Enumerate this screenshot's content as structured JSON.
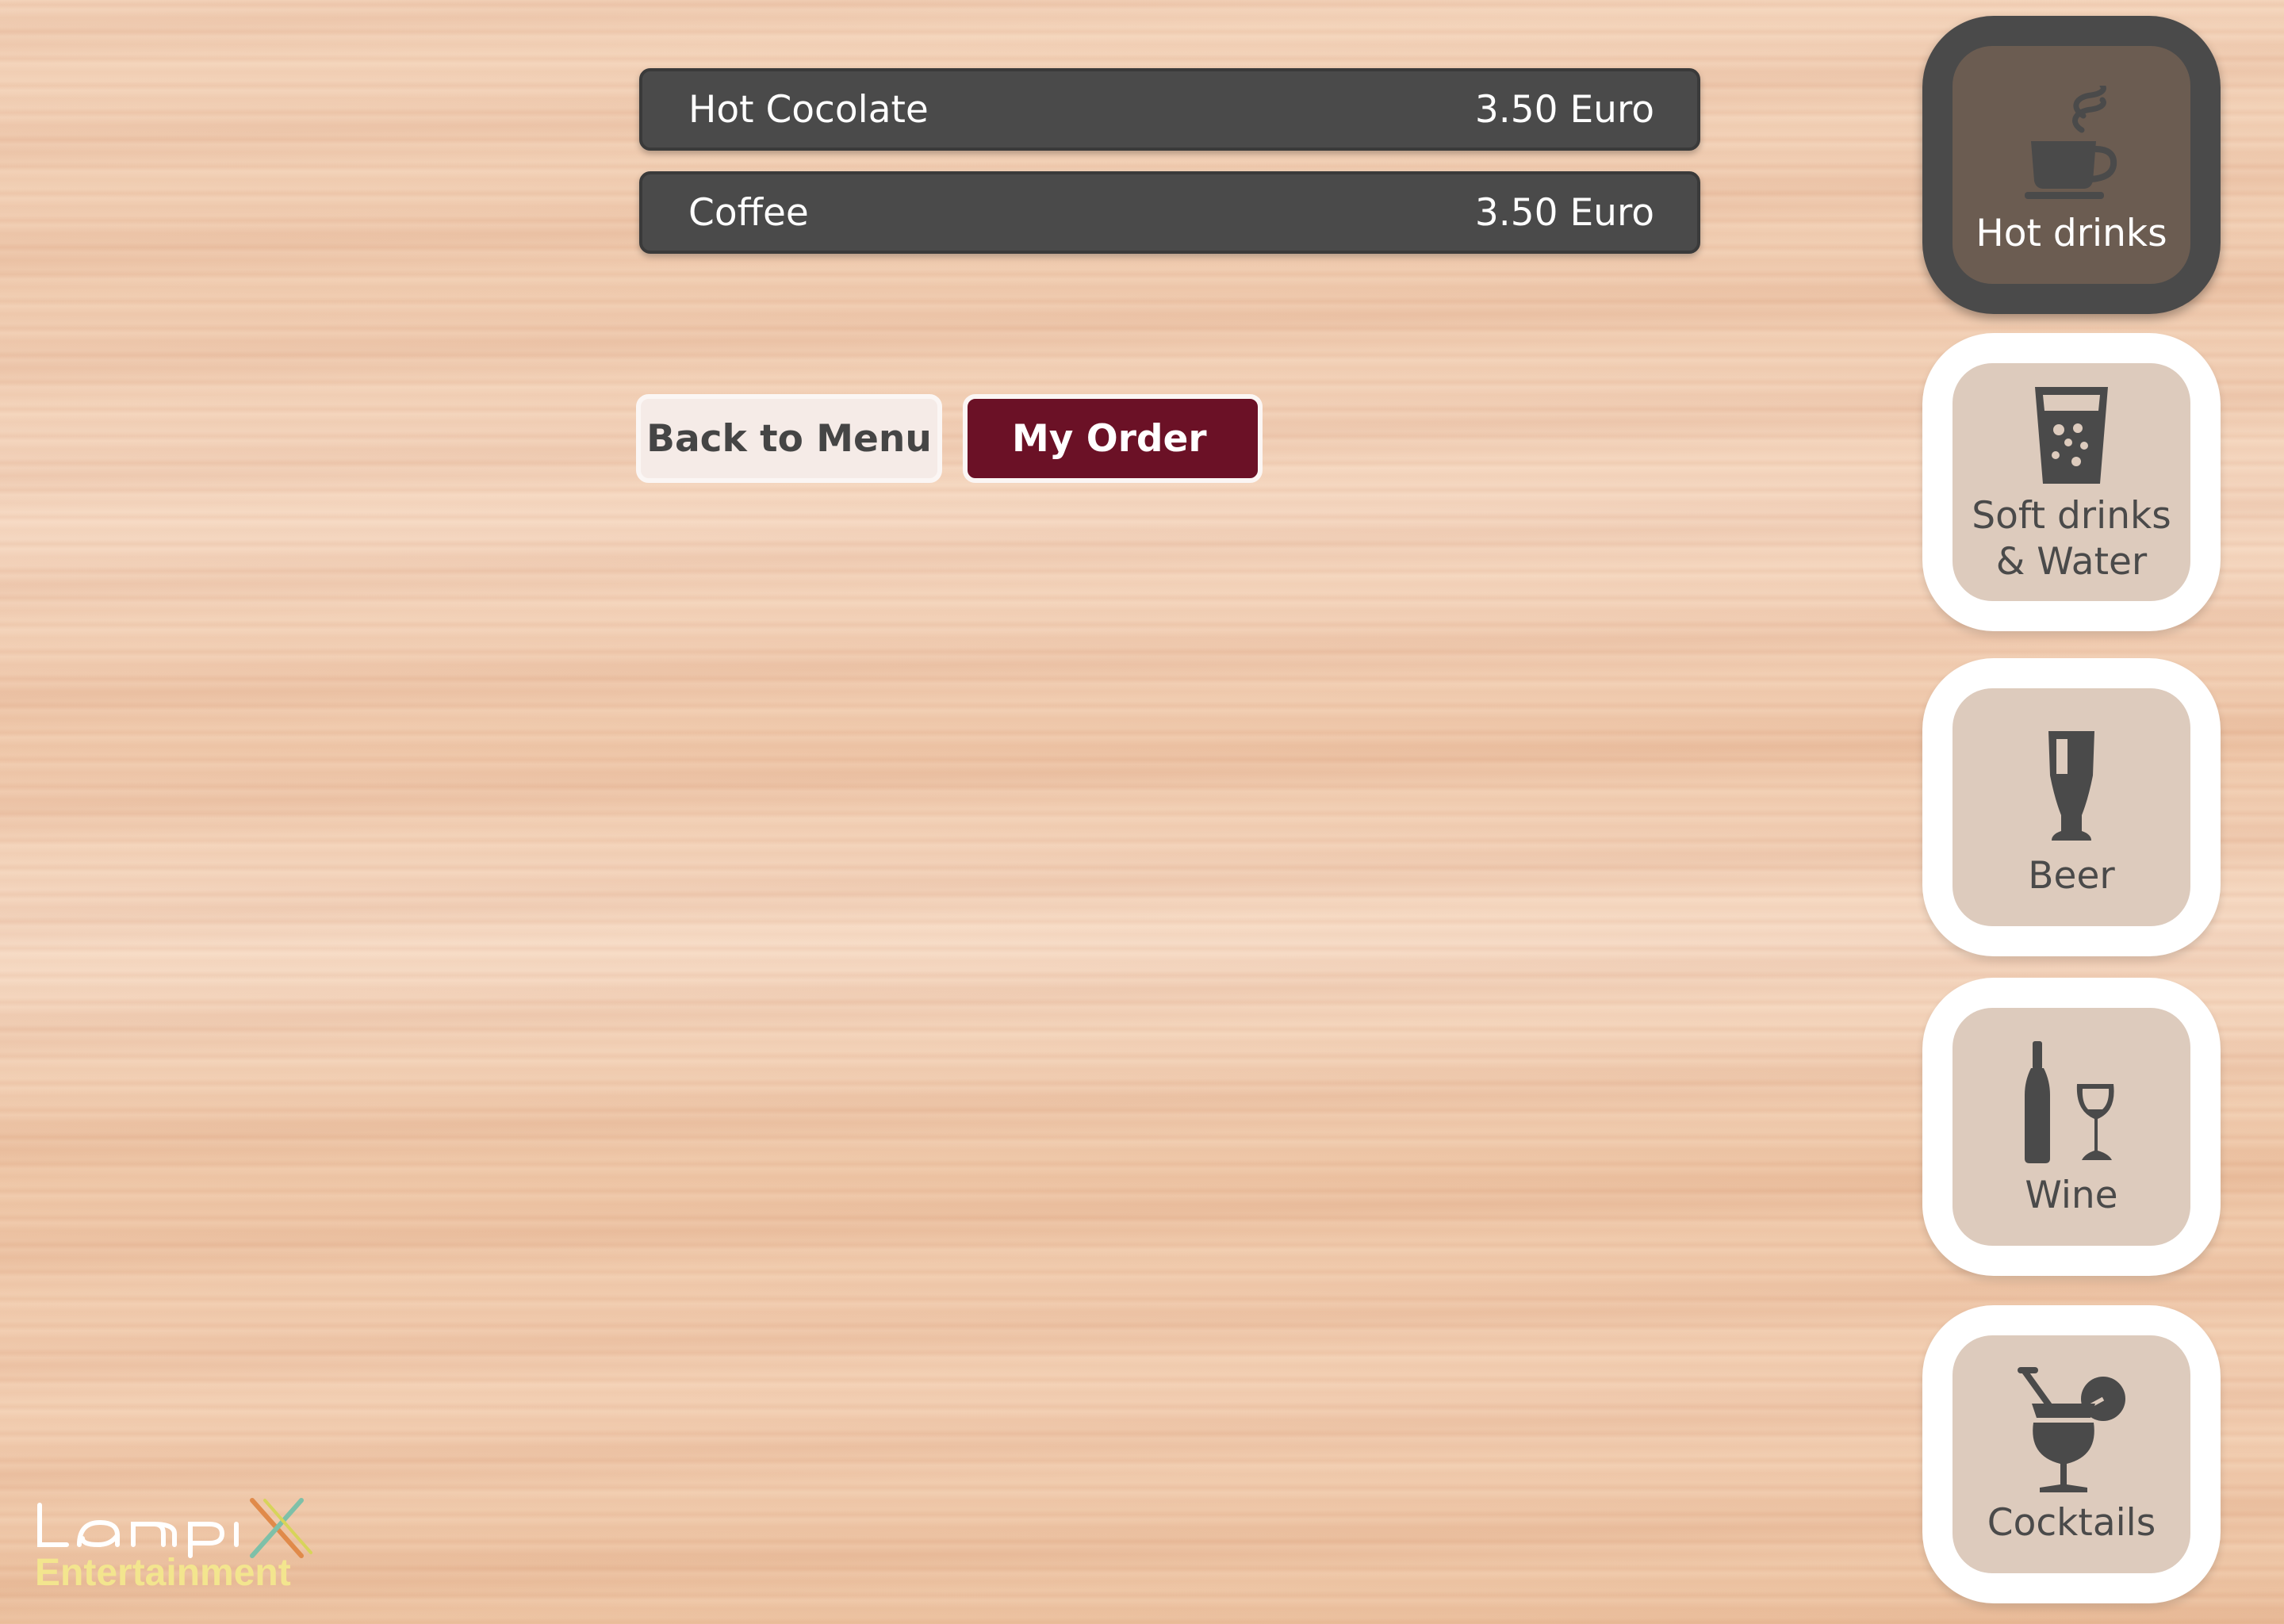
{
  "menu": {
    "items": [
      {
        "name": "Hot Cocolate",
        "price": "3.50 Euro"
      },
      {
        "name": "Coffee",
        "price": "3.50 Euro"
      }
    ]
  },
  "actions": {
    "back_label": "Back to Menu",
    "order_label": "My Order"
  },
  "categories": [
    {
      "label": "Hot drinks",
      "icon": "hot-drink-icon",
      "active": true
    },
    {
      "label": "Soft drinks\n& Water",
      "icon": "soft-drink-icon",
      "active": false
    },
    {
      "label": "Beer",
      "icon": "beer-glass-icon",
      "active": false
    },
    {
      "label": "Wine",
      "icon": "wine-icon",
      "active": false
    },
    {
      "label": "Cocktails",
      "icon": "cocktail-icon",
      "active": false
    }
  ],
  "brand": {
    "logo_text": "Lampix",
    "logo_subtitle": "Entertainment"
  },
  "colors": {
    "item_bg": "#4a4a4a",
    "order_button": "#6b1126",
    "tile_active": "#4a4a4a",
    "tile_inner": "#ddcbbd",
    "logo_sub": "#f3e58e"
  }
}
